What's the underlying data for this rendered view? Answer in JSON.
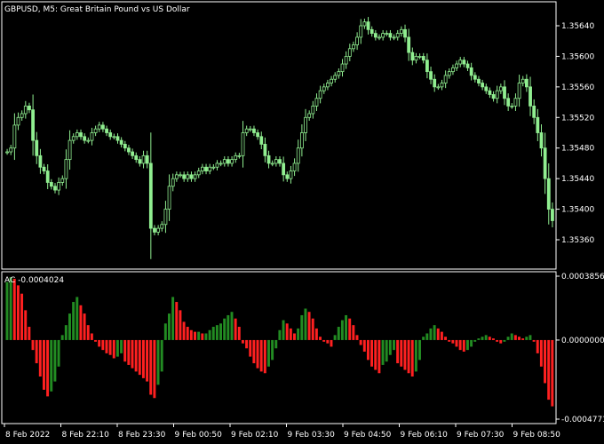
{
  "header": {
    "symbol_label": "GBPUSD, M5:  Great Britain Pound vs US Dollar",
    "indicator_label": "AC -0.0004024"
  },
  "colors": {
    "background": "#000000",
    "frame": "#ffffff",
    "candle": "#90ee90",
    "ac_up": "#228b22",
    "ac_down": "#ff2020",
    "text": "#ffffff"
  },
  "chart_data": [
    {
      "type": "candlestick",
      "title": "GBPUSD, M5:  Great Britain Pound vs US Dollar",
      "ylim": [
        1.35345,
        1.35685
      ],
      "yticks": [
        "1.35640",
        "1.35600",
        "1.35560",
        "1.35520",
        "1.35480",
        "1.35440",
        "1.35400",
        "1.35360"
      ],
      "close": [
        1.35475,
        1.3548,
        1.3551,
        1.3552,
        1.35525,
        1.35535,
        1.3553,
        1.3549,
        1.3547,
        1.35455,
        1.3545,
        1.35435,
        1.3543,
        1.35425,
        1.35435,
        1.3544,
        1.35465,
        1.3549,
        1.35495,
        1.355,
        1.35495,
        1.3549,
        1.3549,
        1.355,
        1.35505,
        1.3551,
        1.35505,
        1.355,
        1.35495,
        1.35495,
        1.3549,
        1.35485,
        1.3548,
        1.35475,
        1.3547,
        1.35465,
        1.3546,
        1.3547,
        1.3546,
        1.35375,
        1.3537,
        1.35375,
        1.3538,
        1.354,
        1.3543,
        1.3544,
        1.35445,
        1.35445,
        1.3544,
        1.35445,
        1.3544,
        1.35445,
        1.3545,
        1.35455,
        1.3545,
        1.35455,
        1.35455,
        1.3546,
        1.3546,
        1.35465,
        1.3546,
        1.35465,
        1.3547,
        1.3547,
        1.355,
        1.35505,
        1.35505,
        1.355,
        1.35495,
        1.35485,
        1.3547,
        1.3546,
        1.3546,
        1.35465,
        1.3546,
        1.35445,
        1.3544,
        1.3545,
        1.3546,
        1.3548,
        1.355,
        1.3552,
        1.35525,
        1.35535,
        1.35545,
        1.35555,
        1.3556,
        1.35565,
        1.3557,
        1.35575,
        1.3558,
        1.3559,
        1.356,
        1.3561,
        1.35615,
        1.35625,
        1.3564,
        1.35645,
        1.35635,
        1.3563,
        1.35625,
        1.35625,
        1.3563,
        1.3563,
        1.35625,
        1.35625,
        1.3563,
        1.35635,
        1.35625,
        1.35605,
        1.35595,
        1.356,
        1.356,
        1.35595,
        1.3558,
        1.3557,
        1.3556,
        1.3556,
        1.35565,
        1.35575,
        1.3558,
        1.35585,
        1.3559,
        1.35595,
        1.3559,
        1.35585,
        1.35575,
        1.3557,
        1.35565,
        1.3556,
        1.35555,
        1.3555,
        1.35545,
        1.35555,
        1.3556,
        1.35545,
        1.35535,
        1.35535,
        1.35545,
        1.35565,
        1.3557,
        1.3556,
        1.35535,
        1.3552,
        1.355,
        1.3548,
        1.3544,
        1.354,
        1.35385
      ]
    },
    {
      "type": "bar",
      "title": "AC -0.0004024",
      "ylim": [
        -0.0004773,
        0.0003856
      ],
      "yticks": [
        "0.0003856",
        "0.0000000",
        "-0.0004773"
      ],
      "values": [
        0.00035,
        0.00038,
        0.00037,
        0.00033,
        0.00028,
        0.00018,
        8e-05,
        -6e-05,
        -0.00014,
        -0.00022,
        -0.0003,
        -0.00034,
        -0.00031,
        -0.00025,
        -0.00016,
        3e-05,
        9e-05,
        0.00016,
        0.00023,
        0.00026,
        0.00021,
        0.00016,
        9e-05,
        4e-05,
        -1e-05,
        -4e-05,
        -6e-05,
        -8e-05,
        -9e-05,
        -0.00011,
        -0.0001,
        -8e-05,
        -0.00013,
        -0.00015,
        -0.00017,
        -0.00019,
        -0.00021,
        -0.00023,
        -0.00025,
        -0.00033,
        -0.00035,
        -0.00027,
        -0.00019,
        0.0001,
        0.00016,
        0.00026,
        0.00023,
        0.00018,
        0.00011,
        8e-05,
        6e-05,
        5e-05,
        5e-05,
        4e-05,
        4e-05,
        6e-05,
        8e-05,
        9e-05,
        0.0001,
        0.00013,
        0.00015,
        0.00017,
        0.00013,
        8e-05,
        -2e-05,
        -5e-05,
        -0.0001,
        -0.00014,
        -0.00017,
        -0.00019,
        -0.0002,
        -0.00016,
        -0.00012,
        -5e-05,
        6e-05,
        0.00012,
        0.0001,
        7e-05,
        4e-05,
        7e-05,
        0.00015,
        0.00019,
        0.00017,
        0.00013,
        7e-05,
        2e-05,
        -1e-05,
        -2e-05,
        -4e-05,
        3e-05,
        8e-05,
        0.00012,
        0.00015,
        0.00013,
        9e-05,
        3e-05,
        -3e-05,
        -7e-05,
        -0.00012,
        -0.00016,
        -0.00018,
        -0.0002,
        -0.00015,
        -0.00013,
        -9e-05,
        -6e-05,
        -0.00014,
        -0.00016,
        -0.00018,
        -0.0002,
        -0.00022,
        -0.00019,
        -0.00012,
        2e-05,
        4e-05,
        7e-05,
        9e-05,
        7e-05,
        5e-05,
        2e-05,
        -1e-05,
        -2e-05,
        -4e-05,
        -6e-05,
        -7e-05,
        -6e-05,
        -4e-05,
        -1e-05,
        1e-05,
        2e-05,
        3e-05,
        2e-05,
        1e-05,
        -1e-05,
        -2e-05,
        -1e-05,
        2e-05,
        4e-05,
        3e-05,
        2e-05,
        1e-05,
        2e-05,
        3e-05,
        -1e-05,
        -8e-05,
        -0.00016,
        -0.00026,
        -0.00036,
        -0.0004
      ]
    }
  ],
  "xaxis": {
    "labels": [
      "8 Feb 2022",
      "8 Feb 22:10",
      "8 Feb 23:30",
      "9 Feb 00:50",
      "9 Feb 02:10",
      "9 Feb 03:30",
      "9 Feb 04:50",
      "9 Feb 06:10",
      "9 Feb 07:30",
      "9 Feb 08:50"
    ]
  }
}
